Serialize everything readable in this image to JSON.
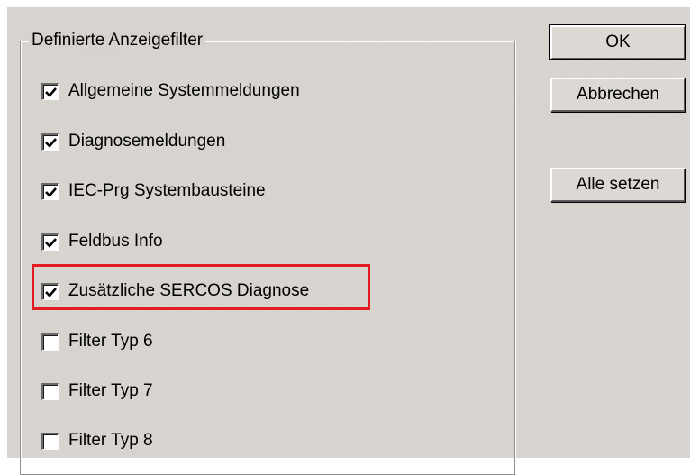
{
  "group": {
    "title": "Definierte Anzeigefilter"
  },
  "filters": [
    {
      "label": "Allgemeine Systemmeldungen",
      "checked": true
    },
    {
      "label": "Diagnosemeldungen",
      "checked": true
    },
    {
      "label": "IEC-Prg Systembausteine",
      "checked": true
    },
    {
      "label": "Feldbus Info",
      "checked": true
    },
    {
      "label": "Zusätzliche SERCOS Diagnose",
      "checked": true,
      "highlighted": true
    },
    {
      "label": "Filter Typ 6",
      "checked": false
    },
    {
      "label": "Filter Typ 7",
      "checked": false
    },
    {
      "label": "Filter Typ 8",
      "checked": false
    }
  ],
  "buttons": {
    "ok": "OK",
    "cancel": "Abbrechen",
    "set_all": "Alle setzen"
  },
  "colors": {
    "dialog_bg": "#d6d3ce",
    "highlight": "#e41b22"
  }
}
